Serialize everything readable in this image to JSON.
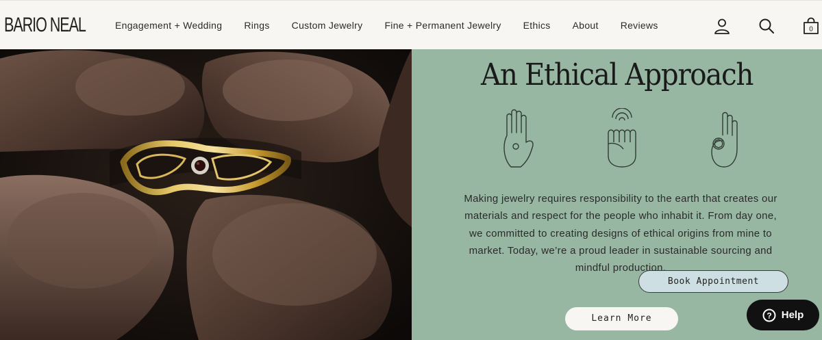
{
  "brand": {
    "logo_text": "BARIO NEAL"
  },
  "nav": {
    "items": [
      {
        "label": "Engagement + Wedding"
      },
      {
        "label": "Rings"
      },
      {
        "label": "Custom Jewelry"
      },
      {
        "label": "Fine + Permanent Jewelry"
      },
      {
        "label": "Ethics"
      },
      {
        "label": "About"
      },
      {
        "label": "Reviews"
      }
    ]
  },
  "header_icons": {
    "account": "user-icon",
    "search": "search-icon",
    "cart": "shopping-bag-icon",
    "cart_count": "0"
  },
  "hero": {
    "image": "hands-holding-gold-ring-photo"
  },
  "panel": {
    "title": "An Ethical Approach",
    "icons": [
      "open-hand-icon",
      "fist-signal-icon",
      "ring-gesture-hand-icon"
    ],
    "body": "Making jewelry requires responsibility to the earth that creates our materials and respect for the people who inhabit it. From day one, we committed to creating designs of ethical origins from mine to market. Today, we’re a proud leader in sustainable sourcing and mindful production.",
    "cta_label": "Learn More",
    "background_color": "#98b7a3"
  },
  "floating": {
    "book_label": "Book Appointment",
    "help_label": "Help"
  }
}
